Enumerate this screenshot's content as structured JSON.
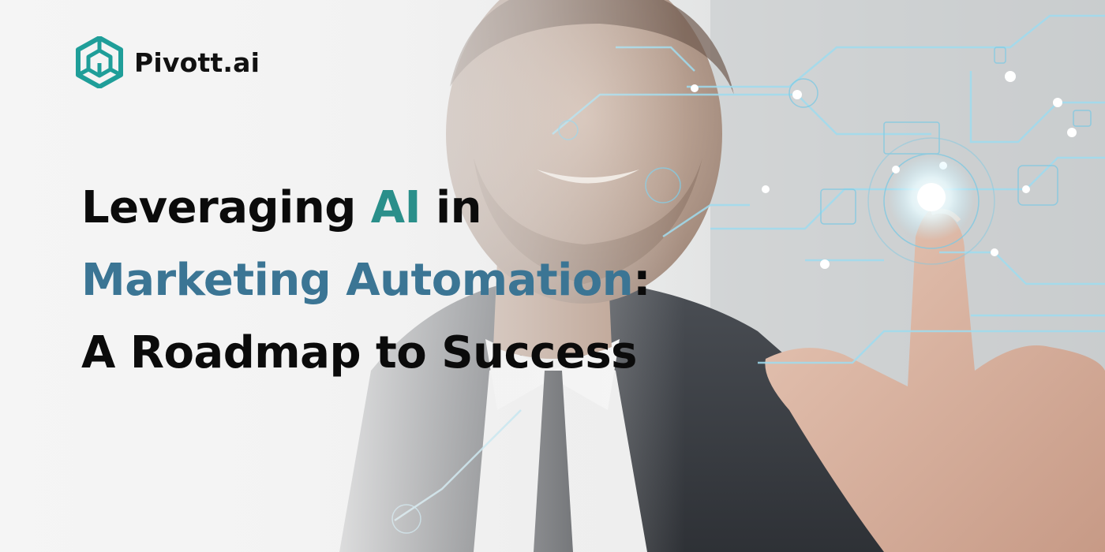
{
  "brand": {
    "name": "Pivott.ai",
    "logo_icon": "hexagon-cube-logo-icon",
    "color": "#1f9e99"
  },
  "headline": {
    "line1_pre": "Leveraging ",
    "line1_accent": "AI",
    "line1_post": " in",
    "line2_accent": "Marketing Automation",
    "line2_post": ":",
    "line3": "A Roadmap to Success"
  },
  "colors": {
    "text": "#0b0b0b",
    "accent_ai": "#2a8f8a",
    "accent_marketing": "#3b7594"
  }
}
